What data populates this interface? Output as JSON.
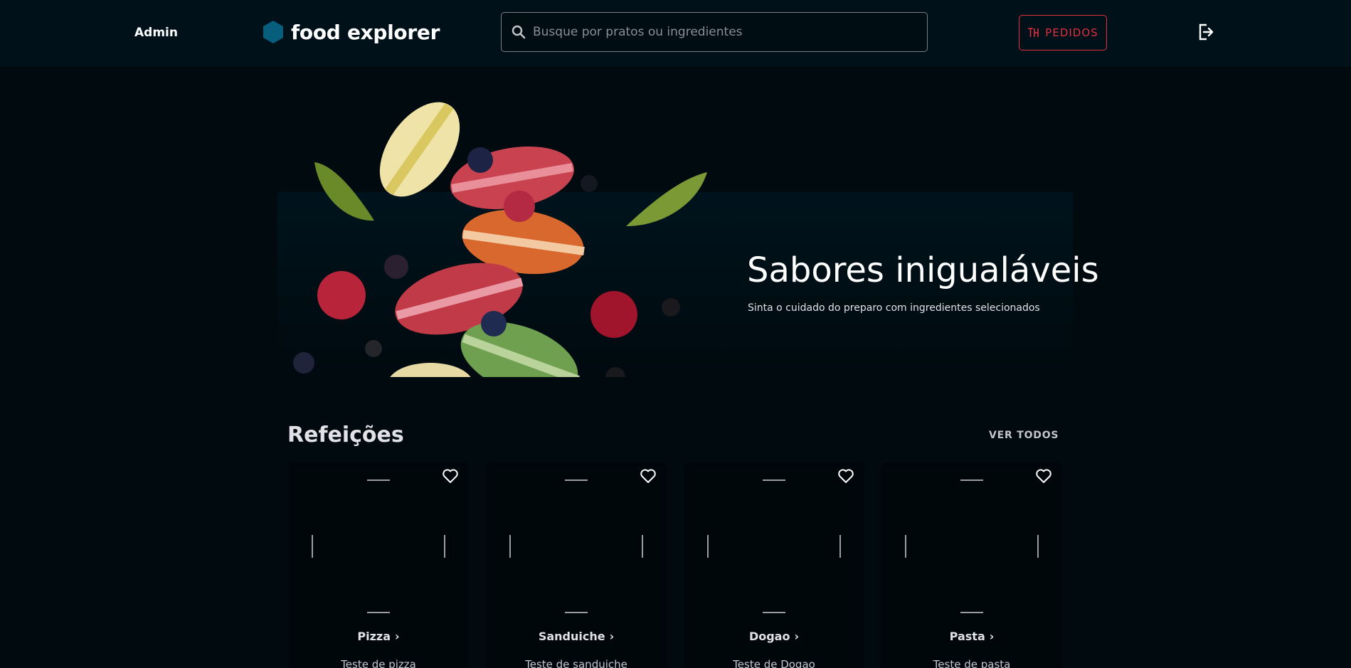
{
  "header": {
    "role_label": "Admin",
    "brand_name": "food explorer",
    "search_placeholder": "Busque por pratos ou ingredientes",
    "orders_label": "PEDIDOS",
    "icons": [
      "hexagon-logo-icon",
      "search-icon",
      "receipt-icon",
      "sign-out-icon"
    ]
  },
  "banner": {
    "title": "Sabores inigualáveis",
    "subtitle": "Sinta o cuidado do preparo com ingredientes selecionados"
  },
  "section": {
    "title": "Refeições",
    "see_all_label": "VER TODOS"
  },
  "dishes": [
    {
      "name": "Pizza",
      "description": "Teste de pizza"
    },
    {
      "name": "Sanduiche",
      "description": "Teste de sanduiche"
    },
    {
      "name": "Dogao",
      "description": "Teste de Dogao"
    },
    {
      "name": "Pasta",
      "description": "Teste de pasta"
    }
  ],
  "colors": {
    "background": "#000a0f",
    "header": "#00111a",
    "accent_red": "#e0303f",
    "logo_blue": "#065e7c"
  }
}
